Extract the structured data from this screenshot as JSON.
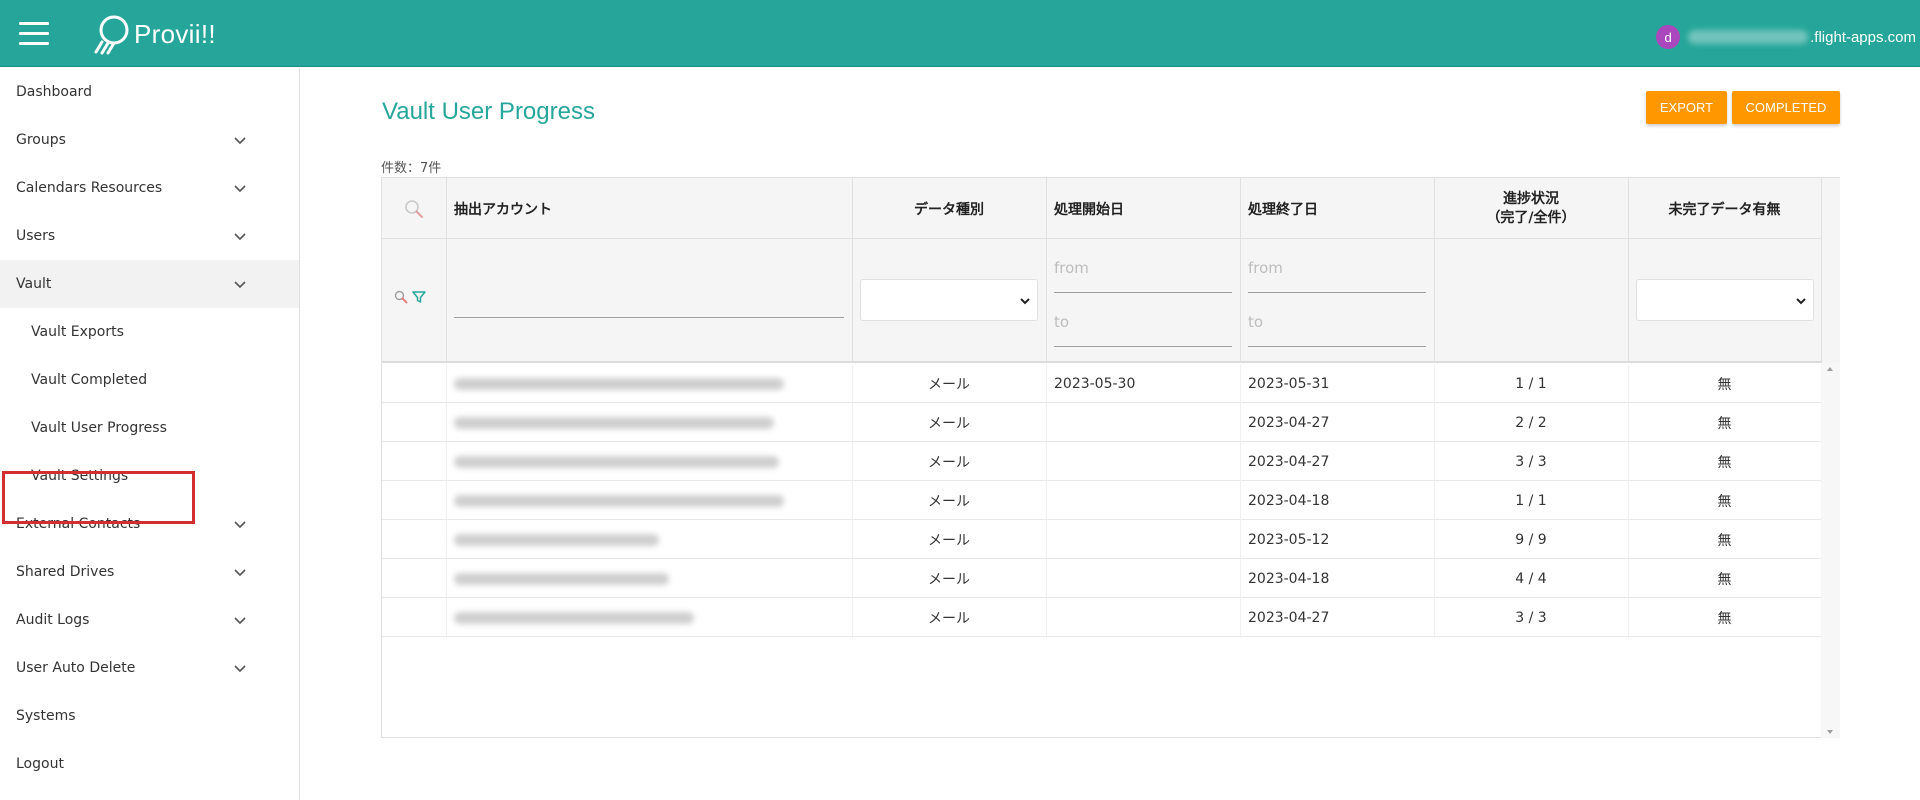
{
  "header": {
    "app_name": "Provii!!",
    "user_initial": "d",
    "user_email_domain": ".flight-apps.com"
  },
  "sidebar": {
    "items": [
      {
        "label": "Dashboard",
        "expandable": false
      },
      {
        "label": "Groups",
        "expandable": true
      },
      {
        "label": "Calendars Resources",
        "expandable": true
      },
      {
        "label": "Users",
        "expandable": true
      },
      {
        "label": "Vault",
        "expandable": true,
        "expanded": true
      },
      {
        "label": "Vault Exports",
        "sub": true
      },
      {
        "label": "Vault Completed",
        "sub": true
      },
      {
        "label": "Vault User Progress",
        "sub": true,
        "highlighted": true
      },
      {
        "label": "Vault Settings",
        "sub": true
      },
      {
        "label": "External Contacts",
        "expandable": true
      },
      {
        "label": "Shared Drives",
        "expandable": true
      },
      {
        "label": "Audit Logs",
        "expandable": true
      },
      {
        "label": "User Auto Delete",
        "expandable": true
      },
      {
        "label": "Systems",
        "expandable": false
      },
      {
        "label": "Logout",
        "expandable": false
      }
    ]
  },
  "main": {
    "title": "Vault User Progress",
    "export_label": "EXPORT",
    "completed_label": "COMPLETED",
    "count_text": "件数：7件"
  },
  "table": {
    "columns": {
      "account": "抽出アカウント",
      "data_type": "データ種別",
      "start_date": "処理開始日",
      "end_date": "処理終了日",
      "progress_line1": "進捗状況",
      "progress_line2": "（完了/全件）",
      "incomplete": "未完了データ有無"
    },
    "filters": {
      "from_placeholder": "from",
      "to_placeholder": "to"
    },
    "rows": [
      {
        "data_type": "メール",
        "start_date": "2023-05-30",
        "end_date": "2023-05-31",
        "progress": "1 / 1",
        "incomplete": "無"
      },
      {
        "data_type": "メール",
        "start_date": "",
        "end_date": "2023-04-27",
        "progress": "2 / 2",
        "incomplete": "無"
      },
      {
        "data_type": "メール",
        "start_date": "",
        "end_date": "2023-04-27",
        "progress": "3 / 3",
        "incomplete": "無"
      },
      {
        "data_type": "メール",
        "start_date": "",
        "end_date": "2023-04-18",
        "progress": "1 / 1",
        "incomplete": "無"
      },
      {
        "data_type": "メール",
        "start_date": "",
        "end_date": "2023-05-12",
        "progress": "9 / 9",
        "incomplete": "無"
      },
      {
        "data_type": "メール",
        "start_date": "",
        "end_date": "2023-04-18",
        "progress": "4 / 4",
        "incomplete": "無"
      },
      {
        "data_type": "メール",
        "start_date": "",
        "end_date": "2023-04-27",
        "progress": "3 / 3",
        "incomplete": "無"
      }
    ]
  },
  "colors": {
    "header_bg": "#26a69a",
    "accent": "#26a69a",
    "button": "#ff9800",
    "highlight_border": "#d32f2f",
    "avatar": "#ab47bc"
  }
}
